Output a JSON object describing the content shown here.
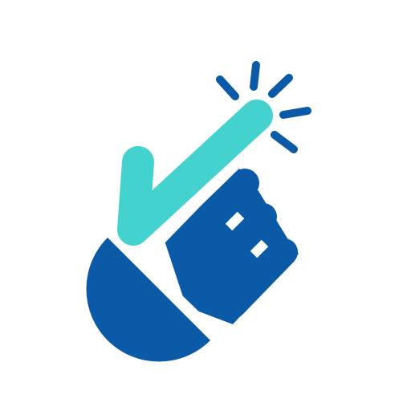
{
  "icon": {
    "name": "click-gesture-icon",
    "colors": {
      "background": "#ffffff",
      "hand": "#0b5aa8",
      "finger": "#44d2cf",
      "spark": "#0b5aa8",
      "gap": "#ffffff"
    }
  }
}
